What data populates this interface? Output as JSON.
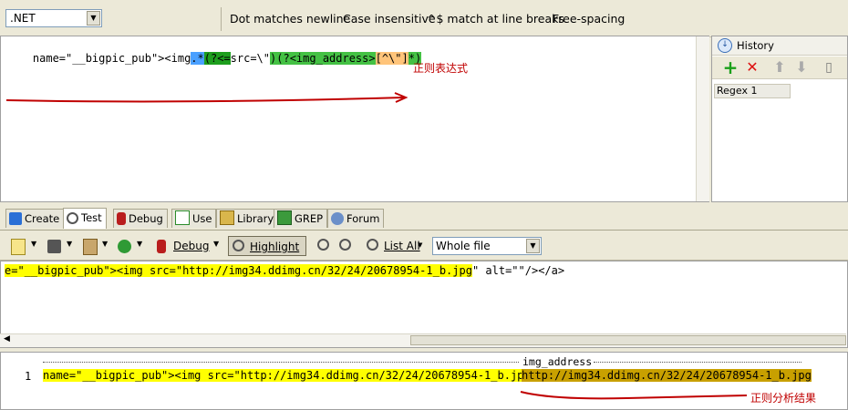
{
  "options": {
    "flavor": ".NET",
    "items": [
      "Dot matches newline",
      "Case insensitive",
      "^$ match at line breaks",
      "Free-spacing"
    ]
  },
  "regex": {
    "parts": [
      {
        "text": "name=\"__bigpic_pub\"><img",
        "style": "plain"
      },
      {
        "text": ".*",
        "style": "blue"
      },
      {
        "text": "(?<=",
        "style": "green-dark"
      },
      {
        "text": "src=\\\"",
        "style": "plain"
      },
      {
        "text": ")(?<img_address>",
        "style": "green"
      },
      {
        "text": "[^\\\"]",
        "style": "orange"
      },
      {
        "text": "*",
        "style": "green"
      },
      {
        "text": ")",
        "style": "green"
      }
    ],
    "annotation": "正则表达式"
  },
  "history": {
    "title": "History",
    "items": [
      "Regex 1"
    ]
  },
  "tabs": [
    "Create",
    "Test",
    "Debug",
    "Use",
    "Library",
    "GREP",
    "Forum"
  ],
  "test_toolbar": {
    "debug_label": "Debug",
    "highlight_label": "Highlight",
    "list_all_label": "List All",
    "scope_value": "Whole file"
  },
  "subject": {
    "match_text": "e=\"__bigpic_pub\"><img src=\"http://img34.ddimg.cn/32/24/20678954-1_b.jpg",
    "rest_text": "\" alt=\"\"/></a>"
  },
  "result": {
    "group_label": "img_address",
    "row_number": "1",
    "match_text": "name=\"__bigpic_pub\"><img src=\"http://img34.ddimg.cn/32/24/20678954-1_b.jpg",
    "group_text": "http://img34.ddimg.cn/32/24/20678954-1_b.jpg",
    "annotation": "正则分析结果"
  },
  "colors": {
    "match_yellow": "#ffff00",
    "group_gold": "#c8a000",
    "annotation_red": "#c00000"
  }
}
